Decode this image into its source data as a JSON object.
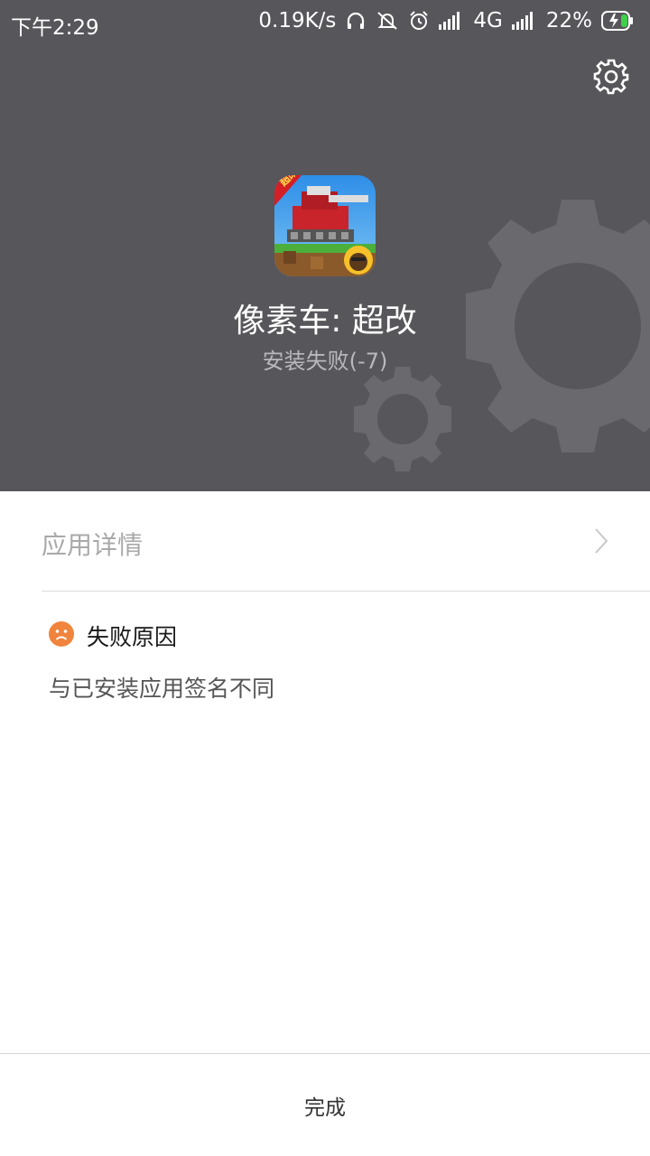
{
  "status_bar": {
    "time": "下午2:29",
    "net_speed": "0.19K/s",
    "network_type": "4G",
    "battery": "22%",
    "icons": [
      "headphones-icon",
      "mute-icon",
      "alarm-icon",
      "signal-icon",
      "signal-icon",
      "battery-charging-icon"
    ]
  },
  "header": {
    "settings_icon": "gear-icon",
    "app_name": "像素车: 超改",
    "install_status": "安装失败(-7)",
    "app_icon_badge": "超改",
    "colors": {
      "background": "#57565b",
      "gear": "#6a696d"
    }
  },
  "details": {
    "label": "应用详情",
    "chevron_icon": "chevron-right-icon"
  },
  "failure": {
    "icon": "sad-face-icon",
    "icon_color": "#f0843c",
    "title": "失败原因",
    "reason": "与已安装应用签名不同"
  },
  "footer": {
    "done_label": "完成"
  }
}
